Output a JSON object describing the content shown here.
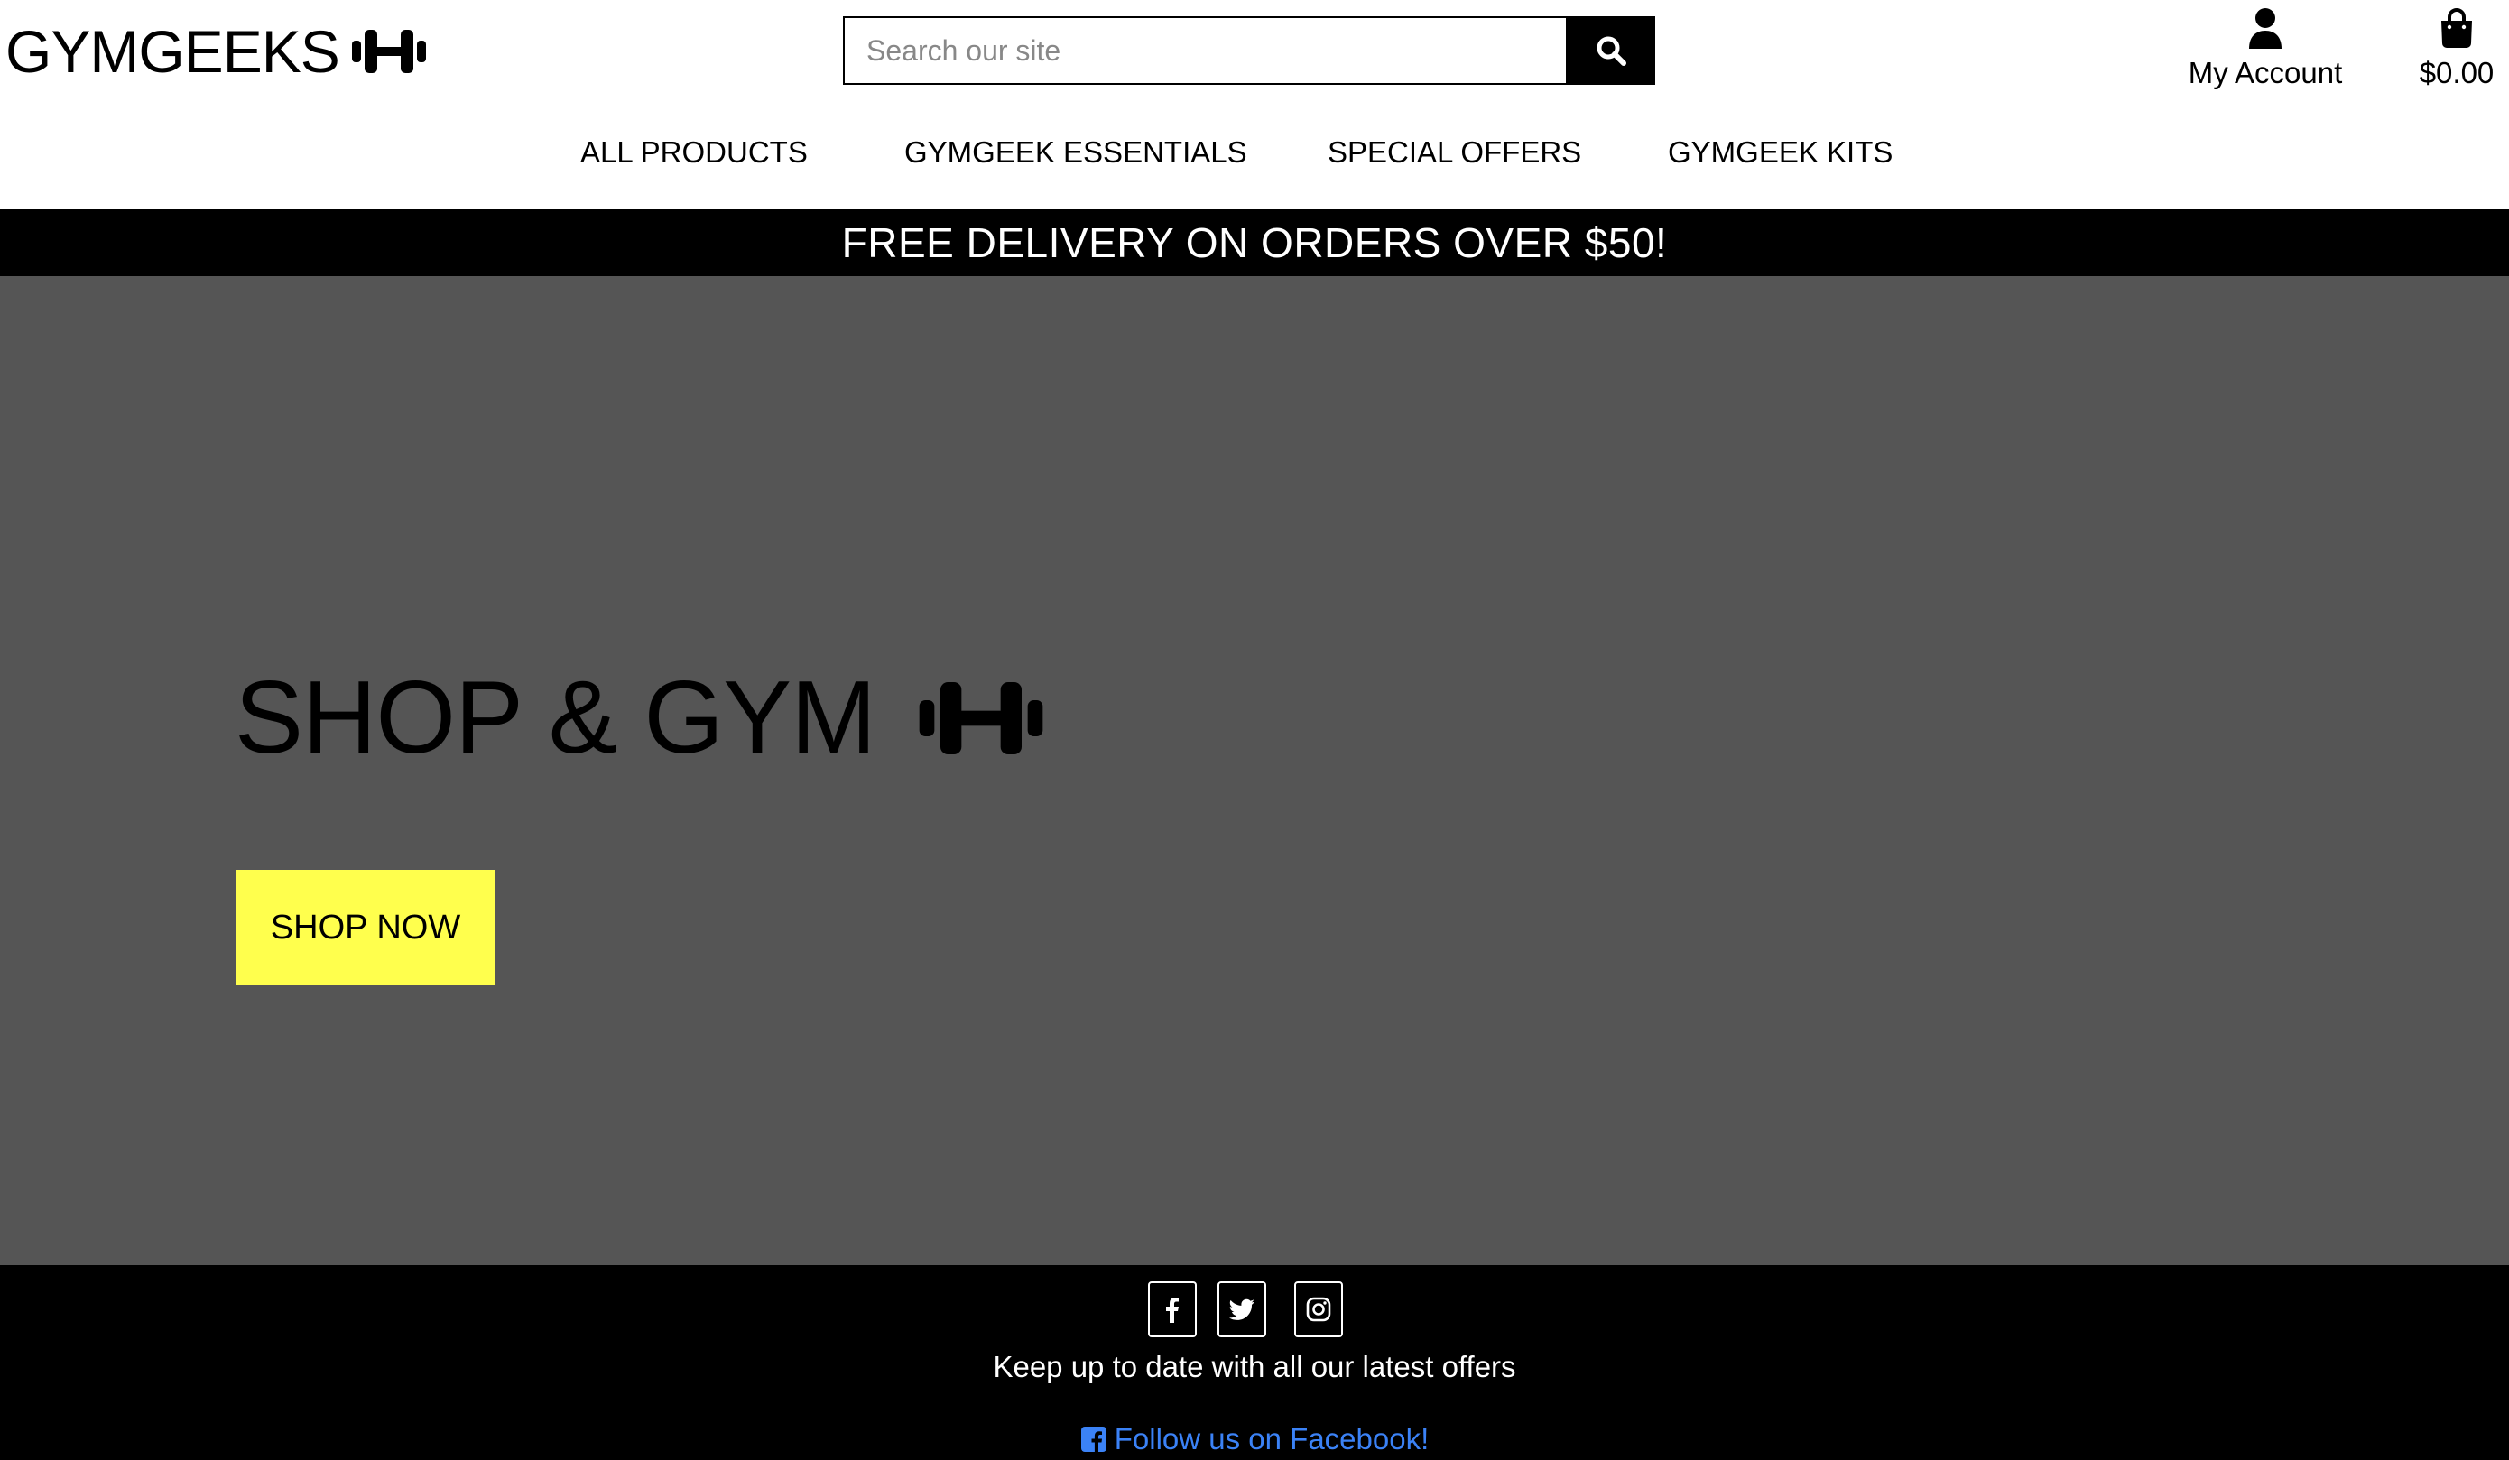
{
  "brand": {
    "name": "GYMGEEKS",
    "logo_icon": "dumbbell-icon"
  },
  "search": {
    "placeholder": "Search our site",
    "value": "",
    "button_icon": "search-icon"
  },
  "account": {
    "icon": "user-icon",
    "label": "My Account"
  },
  "cart": {
    "icon": "shopping-bag-icon",
    "total": "$0.00"
  },
  "nav": {
    "items": [
      {
        "label": "ALL PRODUCTS"
      },
      {
        "label": "GYMGEEK ESSENTIALS"
      },
      {
        "label": "SPECIAL OFFERS"
      },
      {
        "label": "GYMGEEK KITS"
      }
    ]
  },
  "banner": {
    "text": "FREE DELIVERY ON ORDERS OVER $50!"
  },
  "hero": {
    "title": "SHOP & GYM",
    "icon": "dumbbell-icon",
    "cta_label": "SHOP NOW",
    "background_color": "#555555",
    "cta_color": "#ffff4d"
  },
  "footer": {
    "social": [
      {
        "icon": "facebook-icon"
      },
      {
        "icon": "twitter-icon"
      },
      {
        "icon": "instagram-icon"
      }
    ],
    "tagline": "Keep up to date with all our latest offers",
    "facebook_link": "Follow us on Facebook!",
    "link_color": "#3b82f6"
  }
}
